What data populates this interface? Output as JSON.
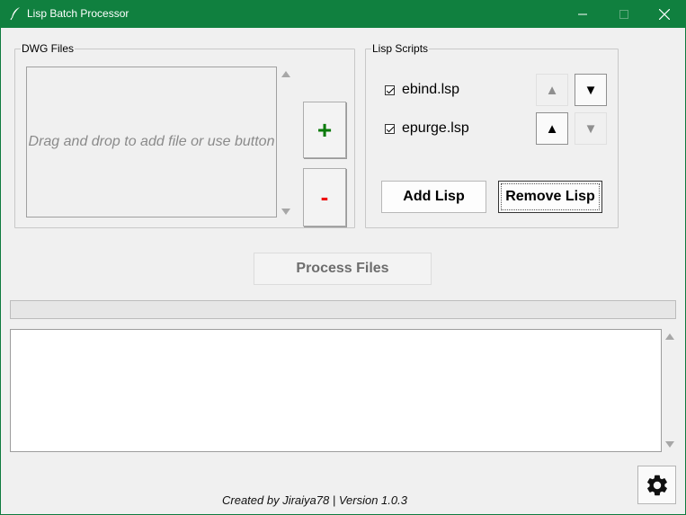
{
  "window": {
    "title": "Lisp Batch Processor",
    "controls": {
      "minimize_icon": "minimize-icon",
      "maximize_icon": "maximize-icon",
      "close_icon": "close-icon"
    }
  },
  "dwg": {
    "group_label": "DWG Files",
    "drop_text": "Drag and drop to add file or use button",
    "add_label": "+",
    "remove_label": "-"
  },
  "lisp": {
    "group_label": "Lisp Scripts",
    "scripts": [
      {
        "name": "ebind.lsp",
        "checked": true,
        "up_enabled": false,
        "down_enabled": true
      },
      {
        "name": "epurge.lsp",
        "checked": true,
        "up_enabled": true,
        "down_enabled": false
      }
    ],
    "up_symbol": "▲",
    "down_symbol": "▼",
    "add_label": "Add Lisp",
    "remove_label": "Remove Lisp"
  },
  "process": {
    "label": "Process Files",
    "enabled": false
  },
  "progress": {
    "value": 0
  },
  "log": {
    "text": ""
  },
  "footer": {
    "credit": "Created by Jiraiya78 | Version 1.0.3"
  },
  "colors": {
    "titlebar": "#10803f",
    "add": "#0a7a0a",
    "remove": "#e11111",
    "background": "#f0f0f0"
  },
  "settings": {
    "icon": "gear-icon"
  }
}
